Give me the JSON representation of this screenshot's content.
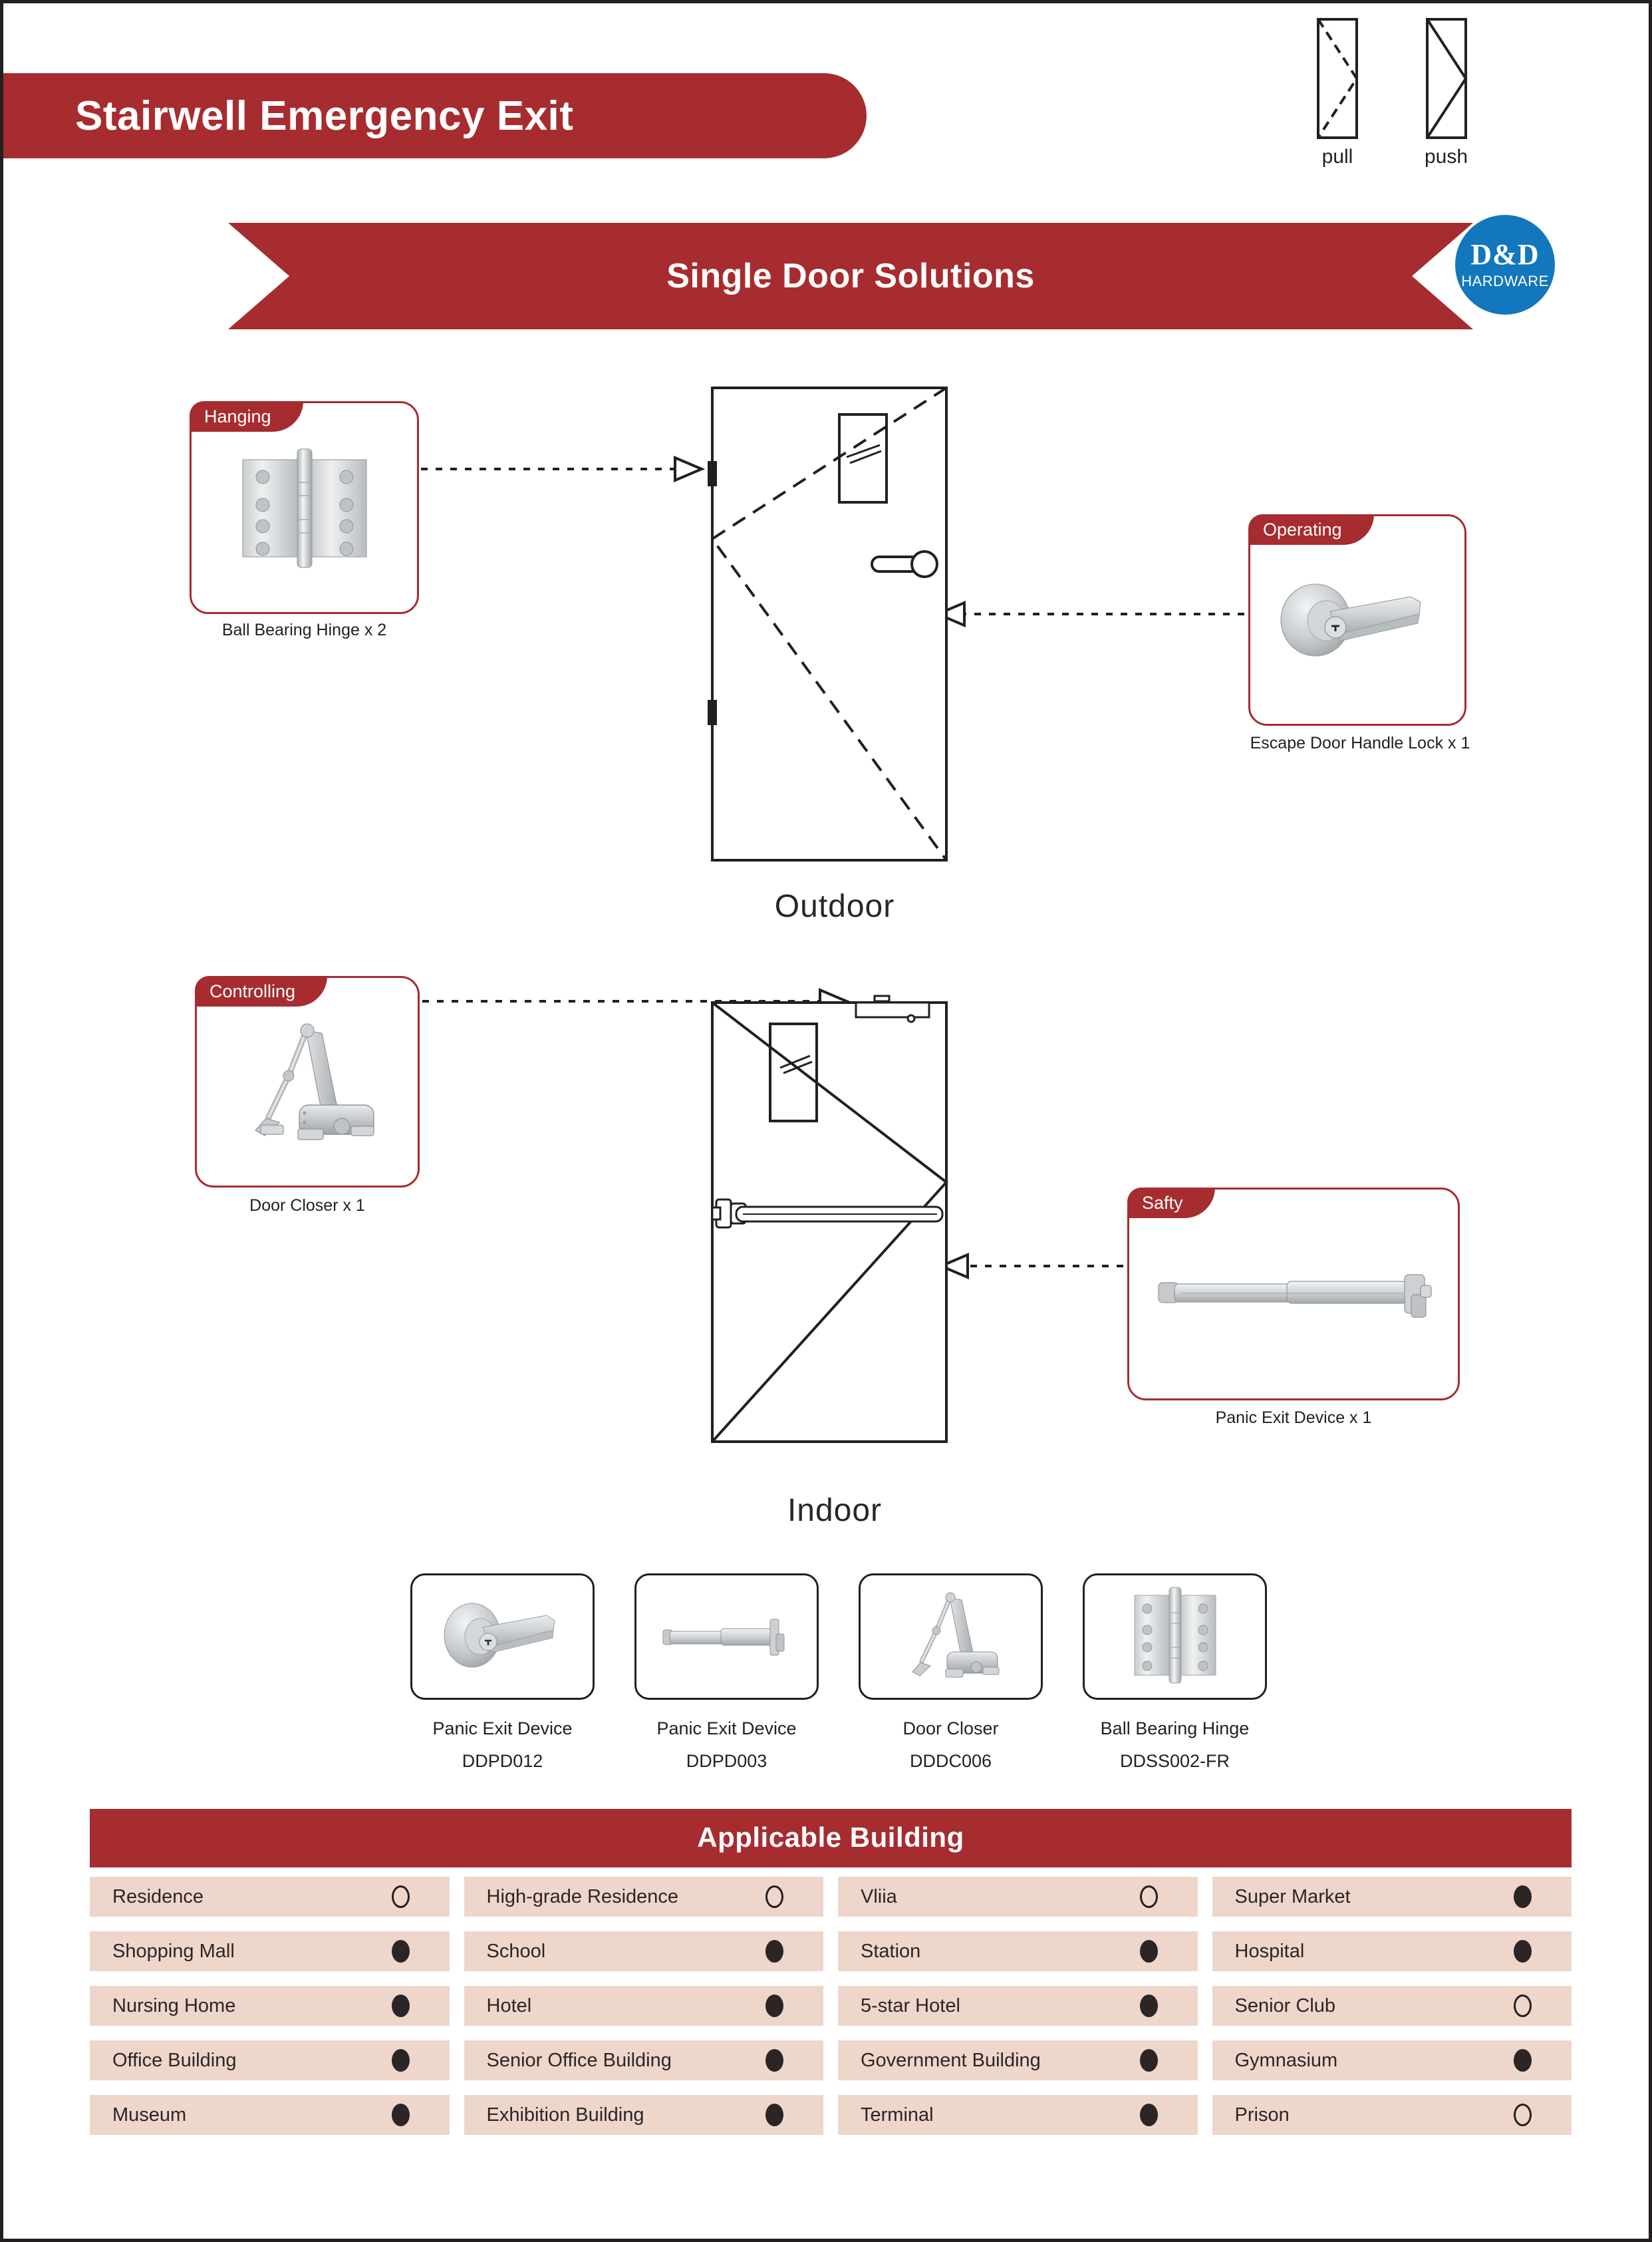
{
  "header": {
    "title": "Stairwell Emergency Exit",
    "subtitle": "Single Door Solutions",
    "logo": {
      "main": "D&D",
      "sub": "HARDWARE"
    },
    "door_symbols": [
      {
        "id": "pull-symbol",
        "caption": "pull"
      },
      {
        "id": "push-symbol",
        "caption": "push"
      }
    ]
  },
  "colors": {
    "brand_red": "#a62c2f",
    "logo_blue": "#1277bc",
    "cell_bg": "#eed6cb",
    "ink": "#231f20"
  },
  "callouts": [
    {
      "tag": "Hanging",
      "caption": "Ball Bearing Hinge x 2"
    },
    {
      "tag": "Operating",
      "caption": "Escape Door Handle Lock  x 1"
    },
    {
      "tag": "Controlling",
      "caption": "Door Closer x 1"
    },
    {
      "tag": "Safty",
      "caption": "Panic Exit Device x 1"
    }
  ],
  "door_views": [
    {
      "label": "Outdoor"
    },
    {
      "label": "Indoor"
    }
  ],
  "products": [
    {
      "name": "Panic Exit Device",
      "model": "DDPD012",
      "icon": "door-lever-lock-icon"
    },
    {
      "name": "Panic Exit Device",
      "model": "DDPD003",
      "icon": "panic-bar-icon"
    },
    {
      "name": "Door Closer",
      "model": "DDDC006",
      "icon": "door-closer-icon"
    },
    {
      "name": "Ball Bearing Hinge",
      "model": "DDSS002-FR",
      "icon": "hinge-icon"
    }
  ],
  "applicable_building": {
    "title": "Applicable Building",
    "rows": [
      [
        {
          "label": "Residence",
          "state": "hollow"
        },
        {
          "label": "High-grade Residence",
          "state": "hollow"
        },
        {
          "label": "Vliia",
          "state": "hollow"
        },
        {
          "label": "Super Market",
          "state": "filled"
        }
      ],
      [
        {
          "label": "Shopping Mall",
          "state": "filled"
        },
        {
          "label": "School",
          "state": "filled"
        },
        {
          "label": "Station",
          "state": "filled"
        },
        {
          "label": "Hospital",
          "state": "filled"
        }
      ],
      [
        {
          "label": "Nursing Home",
          "state": "filled"
        },
        {
          "label": "Hotel",
          "state": "filled"
        },
        {
          "label": "5-star Hotel",
          "state": "filled"
        },
        {
          "label": "Senior Club",
          "state": "hollow"
        }
      ],
      [
        {
          "label": "Office Building",
          "state": "filled"
        },
        {
          "label": "Senior Office Building",
          "state": "filled"
        },
        {
          "label": "Government Building",
          "state": "filled"
        },
        {
          "label": "Gymnasium",
          "state": "filled"
        }
      ],
      [
        {
          "label": "Museum",
          "state": "filled"
        },
        {
          "label": "Exhibition Building",
          "state": "filled"
        },
        {
          "label": "Terminal",
          "state": "filled"
        },
        {
          "label": "Prison",
          "state": "hollow"
        }
      ]
    ]
  }
}
